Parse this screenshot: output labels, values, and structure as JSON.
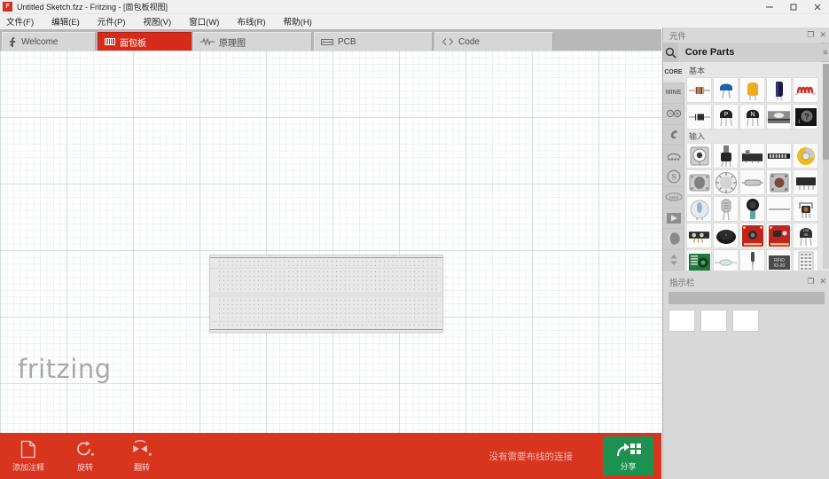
{
  "window": {
    "title": "Untitled Sketch.fzz - Fritzing - [面包板视图]",
    "app_badge": "F",
    "minimize": "—",
    "maximize": "▢",
    "close": "✕"
  },
  "menubar": {
    "items": [
      {
        "label": "文件(F)",
        "name": "menu-file"
      },
      {
        "label": "编辑(E)",
        "name": "menu-edit"
      },
      {
        "label": "元件(P)",
        "name": "menu-part"
      },
      {
        "label": "视图(V)",
        "name": "menu-view"
      },
      {
        "label": "窗口(W)",
        "name": "menu-window"
      },
      {
        "label": "布线(R)",
        "name": "menu-routing"
      },
      {
        "label": "帮助(H)",
        "name": "menu-help"
      }
    ]
  },
  "tabs": [
    {
      "label": "Welcome",
      "icon": "fritzing-f-icon",
      "active": false
    },
    {
      "label": "面包板",
      "icon": "breadboard-icon",
      "active": true
    },
    {
      "label": "原理图",
      "icon": "schematic-icon",
      "active": false
    },
    {
      "label": "PCB",
      "icon": "pcb-icon",
      "active": false
    },
    {
      "label": "Code",
      "icon": "code-icon",
      "active": false
    }
  ],
  "canvas": {
    "watermark": "fritzing",
    "breadboard_label": "full-size-breadboard"
  },
  "bottom_toolbar": {
    "tools": [
      {
        "label": "添加注释",
        "icon": "note-page-icon"
      },
      {
        "label": "旋转",
        "icon": "rotate-icon"
      },
      {
        "label": "翻转",
        "icon": "flip-icon"
      }
    ],
    "status": "没有需要布线的连接",
    "share": {
      "label": "分享",
      "icon": "share-grid-icon"
    }
  },
  "parts_panel": {
    "title": "元件",
    "float_icon": "❐",
    "close_icon": "✕",
    "search_placeholder": "Core Parts",
    "search_value": "Core Parts",
    "search_icon": "search-icon",
    "menu_icon": "≡",
    "bin_tabs": [
      {
        "label": "CORE",
        "name": "bin-tab-core",
        "active": true
      },
      {
        "label": "MINE",
        "name": "bin-tab-mine",
        "active": false
      },
      {
        "label": "∞",
        "name": "bin-tab-arduino",
        "active": false
      },
      {
        "label": "▰",
        "name": "bin-tab-shape",
        "active": false
      },
      {
        "label": "sf",
        "name": "bin-tab-sparkfun",
        "active": false
      },
      {
        "label": "S",
        "name": "bin-tab-snootlab",
        "active": false
      },
      {
        "label": "intel",
        "name": "bin-tab-intel",
        "active": false
      },
      {
        "label": "▶",
        "name": "bin-tab-picaxe",
        "active": false
      },
      {
        "label": "◐",
        "name": "bin-tab-moon",
        "active": false
      },
      {
        "label": "⇕",
        "name": "bin-tab-scroll",
        "active": false
      }
    ],
    "groups": [
      {
        "label": "基本",
        "parts": [
          {
            "name": "part-resistor"
          },
          {
            "name": "part-ceramic-capacitor"
          },
          {
            "name": "part-electrolytic-capacitor"
          },
          {
            "name": "part-tantalum-capacitor"
          },
          {
            "name": "part-inductor"
          },
          {
            "name": "part-diode"
          },
          {
            "name": "part-pnp-transistor"
          },
          {
            "name": "part-npn-transistor"
          },
          {
            "name": "part-ic-chip"
          },
          {
            "name": "part-mystery-part"
          }
        ]
      },
      {
        "label": "输入",
        "parts": [
          {
            "name": "part-trimpot"
          },
          {
            "name": "part-potentiometer"
          },
          {
            "name": "part-slide-switch"
          },
          {
            "name": "part-dip-switch"
          },
          {
            "name": "part-relay"
          },
          {
            "name": "part-rocker-switch"
          },
          {
            "name": "part-rotary-encoder"
          },
          {
            "name": "part-toggle-switch"
          },
          {
            "name": "part-pushbutton"
          },
          {
            "name": "part-dip-header"
          },
          {
            "name": "part-tilt-sensor"
          },
          {
            "name": "part-photoresistor"
          },
          {
            "name": "part-microphone"
          },
          {
            "name": "part-wire-lead"
          },
          {
            "name": "part-ir-receiver"
          },
          {
            "name": "part-force-sensor"
          },
          {
            "name": "part-buzzer"
          },
          {
            "name": "part-sparkfun-board-a"
          },
          {
            "name": "part-sparkfun-board-b"
          },
          {
            "name": "part-temperature-sensor"
          },
          {
            "name": "part-green-module"
          },
          {
            "name": "part-glass-tube-sensor"
          },
          {
            "name": "part-probe-sensor"
          },
          {
            "name": "part-rfid-module"
          },
          {
            "name": "part-led-matrix"
          }
        ]
      }
    ]
  },
  "inspector_panel": {
    "title": "指示栏",
    "float_icon": "❐",
    "close_icon": "✕"
  },
  "colors": {
    "accent_red": "#d8351f",
    "tab_active_red": "#d62b1a",
    "share_green": "#1d9150",
    "dock_gray": "#d8d8d8",
    "canvas_white": "#ffffff"
  }
}
